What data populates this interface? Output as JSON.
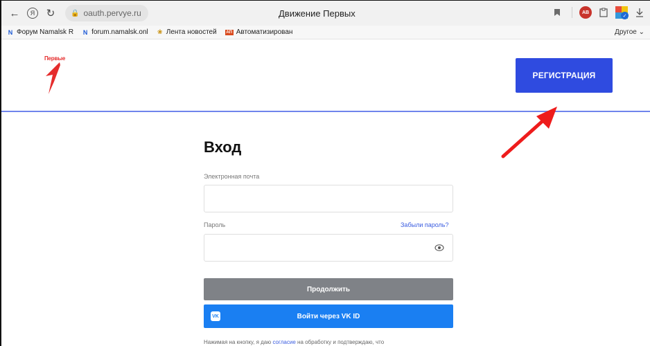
{
  "browser": {
    "address": "oauth.pervye.ru",
    "tab_title": "Движение Первых",
    "bookmarks": [
      {
        "label": "Форум Namalsk R"
      },
      {
        "label": "forum.namalsk.onl"
      },
      {
        "label": "Лента новостей"
      },
      {
        "label": "Автоматизирован"
      }
    ],
    "bookmarks_other": "Другое"
  },
  "header": {
    "logo_text": "Первые",
    "register_label": "РЕГИСТРАЦИЯ"
  },
  "login": {
    "title": "Вход",
    "email_label": "Электронная почта",
    "email_value": "",
    "password_label": "Пароль",
    "password_value": "",
    "forgot_label": "Забыли пароль?",
    "continue_label": "Продолжить",
    "vk_label": "Войти через VK ID",
    "consent_prefix": "Нажимая на кнопку, я даю ",
    "consent_link": "согласие",
    "consent_suffix": " на обработку и подтверждаю, что"
  },
  "colors": {
    "brand_blue": "#2f4be0",
    "vk_blue": "#1a7ff2",
    "logo_red": "#e52d2d",
    "continue_gray": "#7f8287",
    "link_blue": "#3b5de0"
  }
}
